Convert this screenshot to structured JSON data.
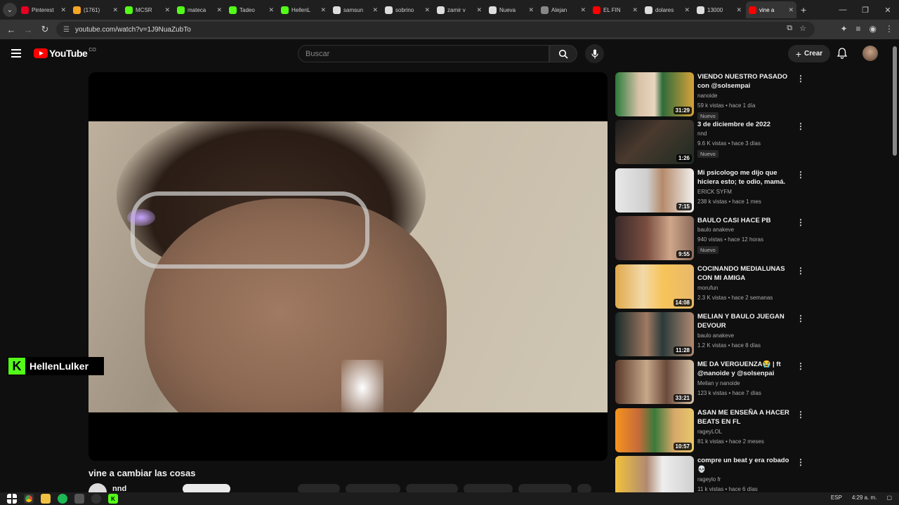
{
  "browser": {
    "tabs": [
      {
        "title": "Pinterest",
        "color": "#e60023"
      },
      {
        "title": "(1761)",
        "color": "#f5a623"
      },
      {
        "title": "MCSR",
        "color": "#53fc18"
      },
      {
        "title": "mateca",
        "color": "#53fc18"
      },
      {
        "title": "Tadeo",
        "color": "#53fc18"
      },
      {
        "title": "HellenL",
        "color": "#53fc18"
      },
      {
        "title": "samsun",
        "color": "#dddddd"
      },
      {
        "title": "sobrino",
        "color": "#dddddd"
      },
      {
        "title": "zamir v",
        "color": "#dddddd"
      },
      {
        "title": "Nueva",
        "color": "#dddddd"
      },
      {
        "title": "Alejan",
        "color": "#888888"
      },
      {
        "title": "EL FIN",
        "color": "#ff0000"
      },
      {
        "title": "dolares",
        "color": "#dddddd"
      },
      {
        "title": "13000",
        "color": "#dddddd"
      },
      {
        "title": "vine a",
        "color": "#ff0000"
      }
    ],
    "url": "youtube.com/watch?v=1J9NuaZubTo"
  },
  "youtube": {
    "logo_text": "YouTube",
    "country_code": "CO",
    "search_placeholder": "Buscar",
    "create_label": "Crear"
  },
  "video": {
    "title": "vine a cambiar las cosas",
    "channel": "nnd",
    "watermark": "HellenLulker"
  },
  "recommendations": [
    {
      "title": "VIENDO NUESTRO PASADO con @solsempai",
      "channel": "nanoide",
      "meta": "59 k vistas • hace 1 día",
      "duration": "31:29",
      "badge": "Nuevo",
      "thumb": "linear-gradient(90deg,#2a7a3a 0%,#d8c2a8 30%,#e9d6c0 50%,#2f6b3a 60%,#d6a23a 100%)"
    },
    {
      "title": "3 de diciembre de 2022",
      "channel": "nnd",
      "meta": "9.6 K vistas • hace 3 días",
      "duration": "1:26",
      "badge": "Nuevo",
      "thumb": "linear-gradient(135deg,#1b1b1b 0%,#4a3a2e 40%,#1e2a22 100%)"
    },
    {
      "title": "Mi psicologo me dijo que hiciera esto; te odio, mamá.",
      "channel": "ERICK SYFM",
      "meta": "238 k vistas • hace 1 mes",
      "duration": "7:15",
      "badge": "",
      "thumb": "linear-gradient(90deg,#e8e8e8 0%,#cfcfcf 40%,#b68a6a 60%,#f1f1f1 100%)"
    },
    {
      "title": "BAULO CASI HACE PB",
      "channel": "baulo anakeve",
      "meta": "940 vistas • hace 12 horas",
      "duration": "9:55",
      "badge": "Nuevo",
      "thumb": "linear-gradient(90deg,#3a2a2a 0%,#7a4e40 40%,#cfa68a 70%,#8a6a5a 100%)"
    },
    {
      "title": "COCINANDO MEDIALUNAS CON MI AMIGA",
      "channel": "morufun",
      "meta": "2.3 K vistas • hace 2 semanas",
      "duration": "14:08",
      "badge": "",
      "thumb": "linear-gradient(90deg,#e0a94a 0%,#f2d9a8 35%,#f7c45a 60%,#e8b86a 100%)"
    },
    {
      "title": "MELIAN Y BAULO JUEGAN DEVOUR",
      "channel": "baulo anakeve",
      "meta": "1.2 K vistas • hace 8 días",
      "duration": "11:28",
      "badge": "",
      "thumb": "linear-gradient(90deg,#1a2a2a 0%,#a07a62 40%,#2a3a3a 60%,#b08a72 100%)"
    },
    {
      "title": "ME DA VERGUENZA😭 | ft @nanoide y @solsenpai",
      "channel": "Melian y nanoide",
      "meta": "123 k vistas • hace 7 días",
      "duration": "33:21",
      "badge": "",
      "thumb": "linear-gradient(90deg,#5a3a2a 0%,#c8a88a 40%,#6a4a3a 65%,#d9c3a8 100%)"
    },
    {
      "title": "ASAN ME ENSEÑA A HACER BEATS EN FL",
      "channel": "rageyLOL",
      "meta": "81 k vistas • hace 2 meses",
      "duration": "10:57",
      "badge": "",
      "thumb": "linear-gradient(90deg,#f7941d 0%,#c56a3a 30%,#3a7a3a 50%,#d8a86a 75%,#e8c86a 100%)"
    },
    {
      "title": "compre un beat y era robado 💀",
      "channel": "rageylo fr",
      "meta": "11 k vistas • hace 6 días",
      "duration": "",
      "badge": "",
      "thumb": "linear-gradient(90deg,#f2c23a 0%,#b08a72 40%,#eeeeee 60%,#d0d0d0 100%)"
    }
  ],
  "taskbar": {
    "lang": "ESP",
    "time": "4:29 a. m."
  }
}
